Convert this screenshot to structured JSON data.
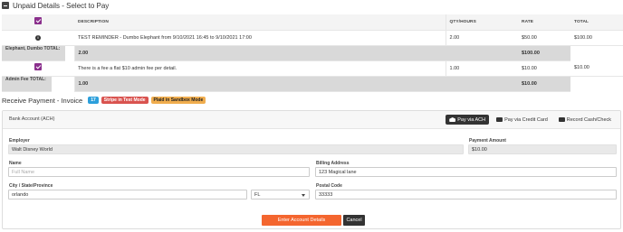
{
  "header": {
    "title": "Unpaid Details - Select to Pay"
  },
  "table": {
    "columns": [
      "DESCRIPTION",
      "QTY/HOURS",
      "RATE",
      "TOTAL"
    ],
    "rows": [
      {
        "description": "TEST REMINDER - Dumbo Elephant from 9/10/2021 16:45 to 9/10/2021 17:00",
        "qty": "2.00",
        "rate": "$50.00",
        "total": "$100.00"
      },
      {
        "total_label": "Elephant, Dumbo TOTAL:",
        "qty": "2.00",
        "total": "$100.00"
      },
      {
        "description": "There is a fee a flat $10 admin fee per detail.",
        "qty": "1.00",
        "rate": "$10.00",
        "total": "$10.00"
      },
      {
        "total_label": "Admin Fee TOTAL:",
        "qty": "1.00",
        "total": "$10.00"
      }
    ]
  },
  "receive": {
    "title": "Receive Payment - Invoice",
    "count_badge": "17",
    "stripe_badge": "Stripe in Test Mode",
    "plaid_badge": "Plaid in Sandbox Mode"
  },
  "panel": {
    "title": "Bank Account (ACH)",
    "pay_ach": "Pay via ACH",
    "pay_card": "Pay via Credit Card",
    "record_cash": "Record Cash/Check"
  },
  "form": {
    "employer_label": "Employer",
    "employer_value": "Walt Disney World",
    "payment_amount_label": "Payment Amount",
    "payment_amount_value": "$10.00",
    "name_label": "Name",
    "name_placeholder": "Full Name",
    "billing_label": "Billing Address",
    "billing_value": "123 Magical lane",
    "city_label": "City / State/Province",
    "city_value": "orlando",
    "state_value": "FL",
    "postal_label": "Postal Code",
    "postal_value": "33333"
  },
  "actions": {
    "enter": "Enter Account Details",
    "cancel": "Cancel"
  },
  "colors": {
    "checkbox": "#8a2f8c",
    "enter_button": "#f4662f",
    "stripe_badge": "#d9534f",
    "plaid_badge": "#f0ad4e",
    "count_badge": "#2c9fdb"
  }
}
